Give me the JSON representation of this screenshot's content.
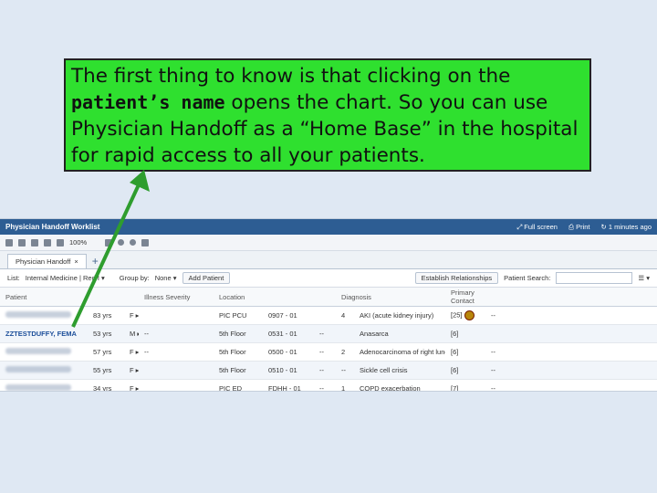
{
  "callout": {
    "text_before": "The first thing to know is that clicking on the ",
    "text_bold": "patient’s name",
    "text_after": " opens the chart.  So you can use Physician Handoff as a “Home Base” in the hospital for rapid access to all your patients."
  },
  "app": {
    "title": "Physician Handoff Worklist",
    "fullscreen_label": "Full screen",
    "print_label": "Print",
    "minutes_ago": "1 minutes ago",
    "zoom": "100%",
    "tab_label": "Physician Handoff",
    "filter": {
      "list_label": "List:",
      "list_value": "Internal Medicine | Red I",
      "group_label": "Group by:",
      "group_value": "None",
      "add_patient": "Add Patient",
      "establish": "Establish Relationships",
      "patient_search": "Patient Search:"
    },
    "columns": [
      "Patient",
      "",
      "",
      "Illness Severity",
      "Location",
      "",
      "",
      "Diagnosis",
      "",
      "Primary Contact",
      "",
      "",
      ""
    ],
    "rows": [
      {
        "name": "",
        "age": "83 yrs",
        "sex": "F",
        "location": "PIC PCU",
        "room": "0907 - 01",
        "c1": "",
        "c2": "4",
        "diagnosis": "AKI (acute kidney injury)",
        "days": "[25]",
        "contact": "--"
      },
      {
        "name": "ZZTESTDUFFY, FEMA",
        "age": "53 yrs",
        "sex": "M",
        "severity": "--",
        "location": "5th Floor",
        "room": "0531 - 01",
        "c1": "--",
        "c2": "",
        "diagnosis": "Anasarca",
        "days": "[6]",
        "contact": ""
      },
      {
        "name": "",
        "age": "57 yrs",
        "sex": "F",
        "severity": "--",
        "location": "5th Floor",
        "room": "0500 - 01",
        "c1": "--",
        "c2": "2",
        "diagnosis": "Adenocarcinoma of right lung",
        "days": "[6]",
        "contact": "--"
      },
      {
        "name": "",
        "age": "55 yrs",
        "sex": "F",
        "severity": "",
        "location": "5th Floor",
        "room": "0510 - 01",
        "c1": "--",
        "c2": "--",
        "diagnosis": "Sickle cell crisis",
        "days": "[6]",
        "contact": "--"
      },
      {
        "name": "",
        "age": "34 yrs",
        "sex": "F",
        "severity": "",
        "location": "PIC ED",
        "room": "FDHH - 01",
        "c1": "--",
        "c2": "1",
        "diagnosis": "COPD exacerbation",
        "days": "[7]",
        "contact": "--"
      }
    ]
  }
}
